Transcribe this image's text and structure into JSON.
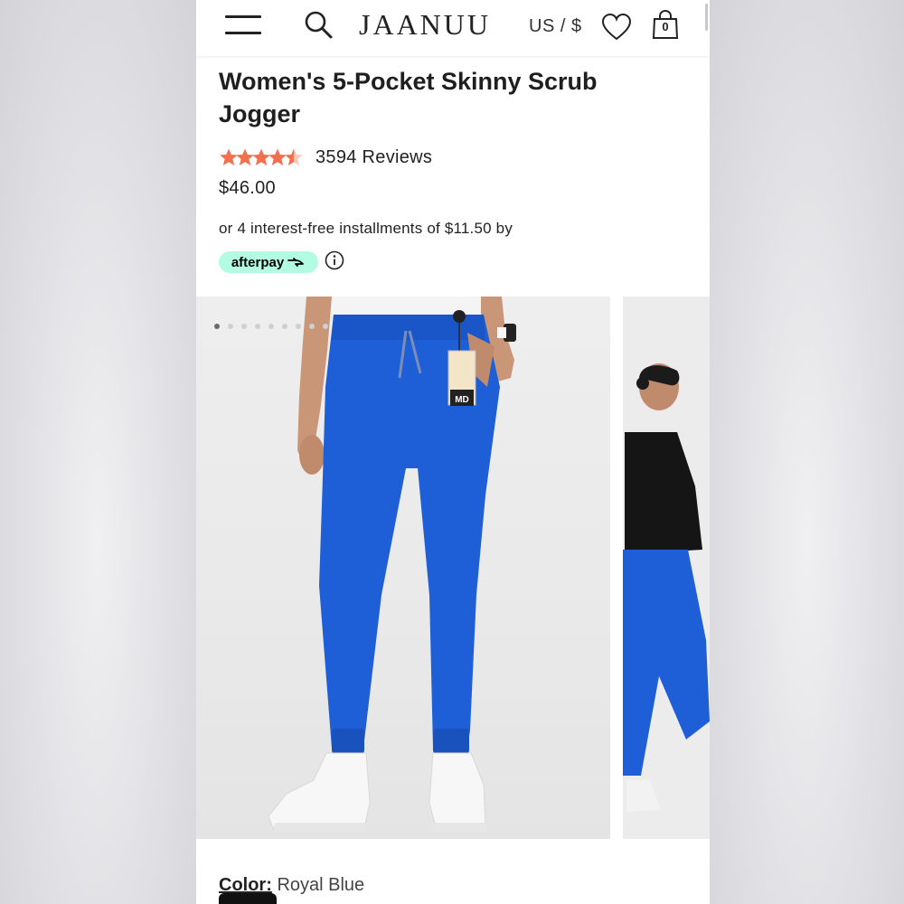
{
  "header": {
    "brand": "JAANUU",
    "region": "US / $",
    "cart_count": "0",
    "icons": [
      "menu-icon",
      "search-icon",
      "heart-icon",
      "shopping-bag-icon"
    ]
  },
  "product": {
    "title": "Women's 5-Pocket Skinny Scrub Jogger",
    "rating": 4.5,
    "rating_max": 5,
    "reviews": "3594 Reviews",
    "price": "$46.00",
    "installments": "or 4 interest-free installments of $11.50 by",
    "afterpay_label": "afterpay",
    "color_label": "Color:",
    "color_value": "Royal Blue"
  },
  "gallery": {
    "total_images": 9,
    "active_index": 0,
    "badge_text": "MD"
  },
  "colors": {
    "star": "#f26f4f",
    "afterpay_bg": "#b2fce4",
    "pants": "#1e5fd8",
    "text": "#222222"
  }
}
